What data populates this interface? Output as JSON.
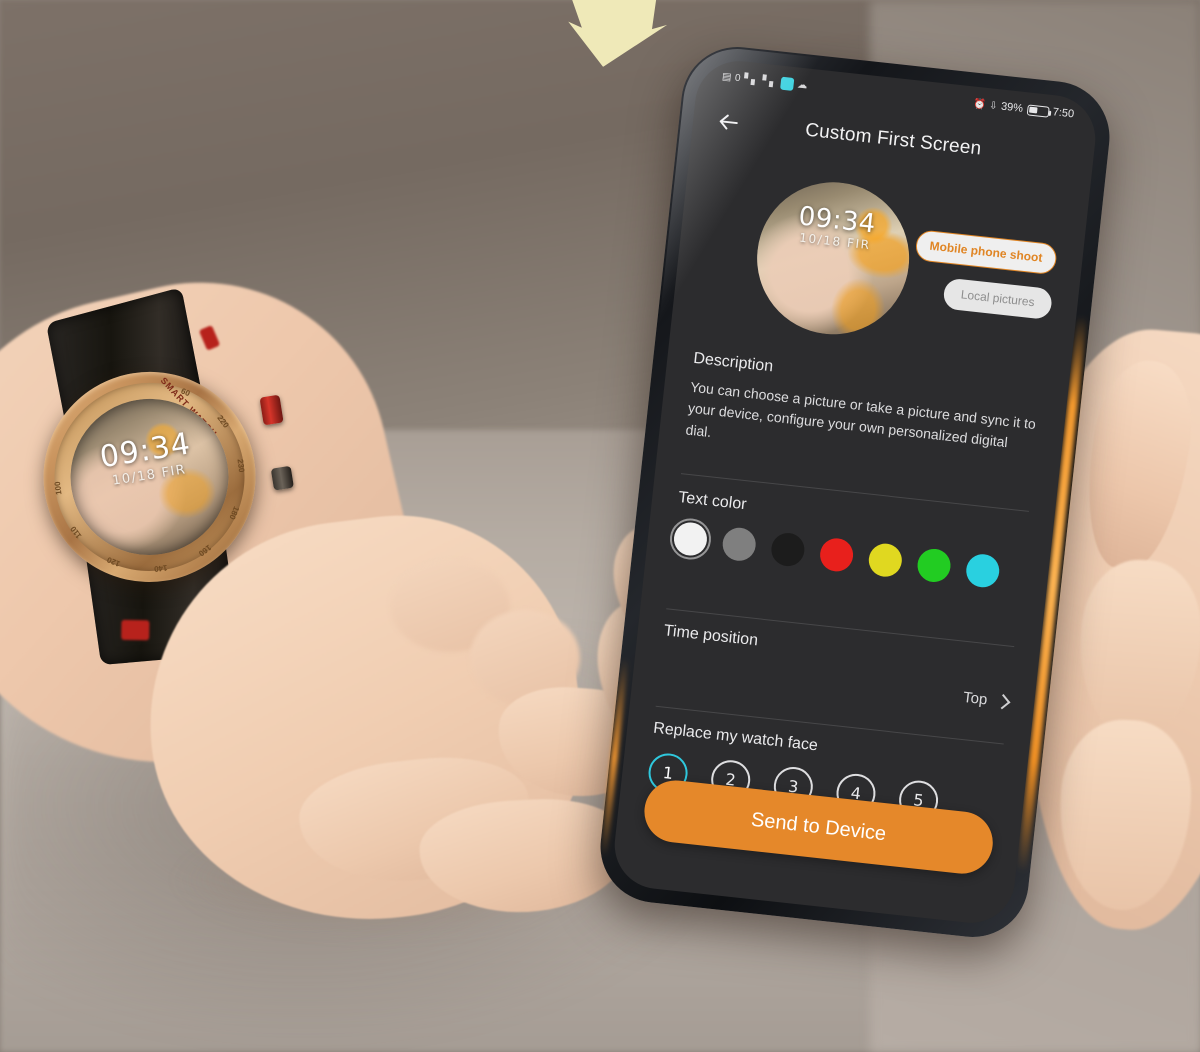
{
  "statusbar": {
    "left_icons": [
      "sim-signal-icon",
      "signal-4g-icon",
      "signal-4g-alt-icon",
      "app-chip-icon",
      "cloud-sync-icon"
    ],
    "sim_label": "0",
    "net_label_1": "4G",
    "net_label_2": "4G",
    "alarm_icon": "alarm-clock-icon",
    "bluetooth_icon": "bluetooth-icon",
    "battery_percent": "39%",
    "time": "7:50"
  },
  "nav": {
    "back_icon": "back-arrow-icon",
    "title": "Custom First Screen"
  },
  "preview": {
    "time": "09:34",
    "date": "10/18  FIR"
  },
  "source_buttons": [
    {
      "label": "Mobile phone shoot",
      "state": "active"
    },
    {
      "label": "Local pictures",
      "state": "inactive"
    }
  ],
  "description": {
    "label": "Description",
    "text": "You can choose a picture or take a picture and sync it to your device, configure your own personalized digital dial."
  },
  "text_color": {
    "label": "Text color",
    "selected_index": 0,
    "swatches": [
      {
        "name": "white",
        "hex": "#f2f2f2"
      },
      {
        "name": "gray",
        "hex": "#7f7f7f"
      },
      {
        "name": "black",
        "hex": "#1c1c1c"
      },
      {
        "name": "red",
        "hex": "#e8201c"
      },
      {
        "name": "yellow",
        "hex": "#e0d820"
      },
      {
        "name": "green",
        "hex": "#22cc22"
      },
      {
        "name": "cyan",
        "hex": "#29d0e0"
      }
    ]
  },
  "time_position": {
    "label": "Time position",
    "value": "Top",
    "chevron_icon": "chevron-right-icon"
  },
  "watch_face_slots": {
    "label": "Replace my watch face",
    "selected_index": 0,
    "slots": [
      "1",
      "2",
      "3",
      "4",
      "5"
    ]
  },
  "send_button": {
    "label": "Send to Device",
    "color": "#e5882a"
  },
  "smartwatch": {
    "face_time": "09:34",
    "face_date": "10/18  FIR",
    "brand_text": "SMART WATCH",
    "bezel_numbers": [
      "60",
      "220",
      "230",
      "180",
      "160",
      "140",
      "120",
      "110",
      "100"
    ]
  },
  "scene": {
    "top_arrow_icon": "down-arrow-pointer",
    "accent_orange": "#e5882a",
    "accent_cyan": "#2fc8dd"
  }
}
